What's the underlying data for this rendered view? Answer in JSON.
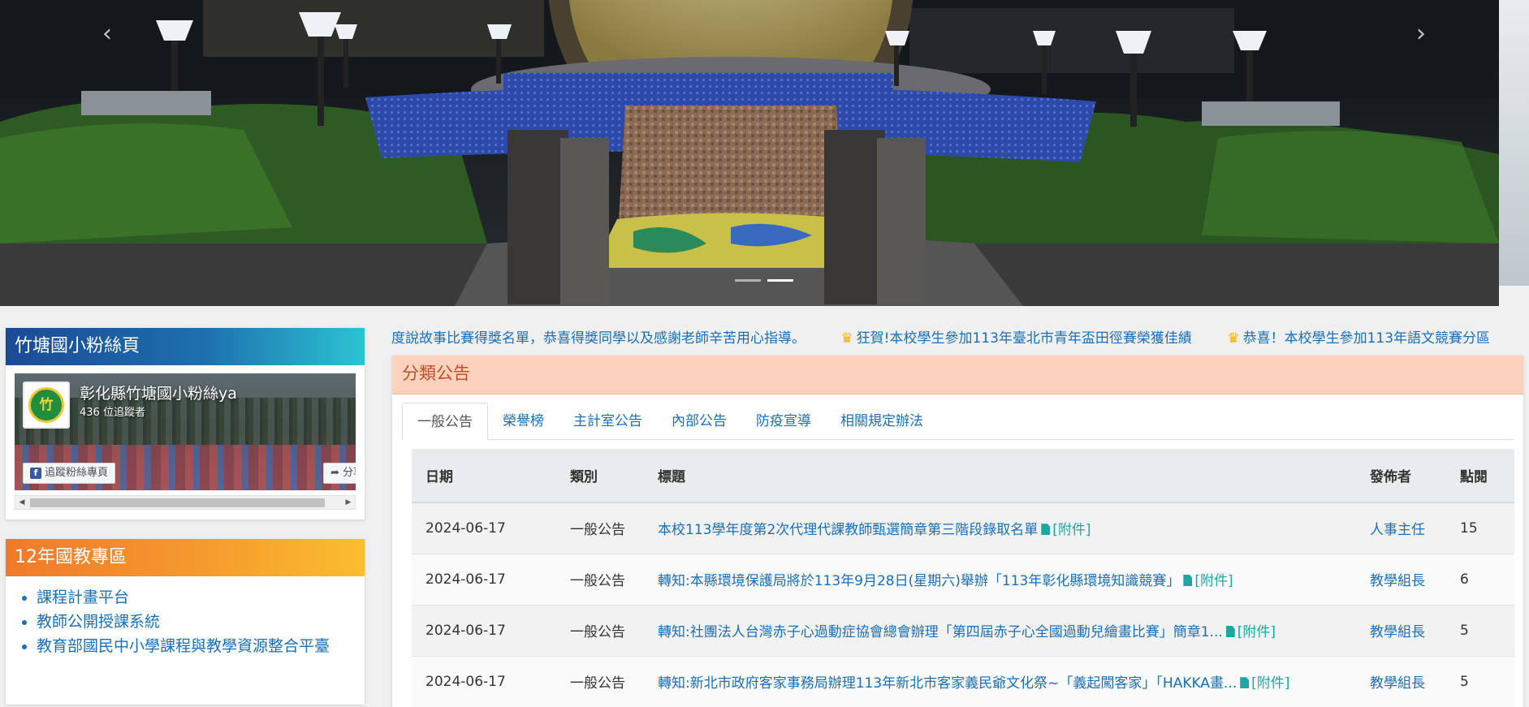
{
  "carousel": {
    "prev_icon": "chevron-left-icon",
    "next_icon": "chevron-right-icon",
    "prev_glyph": "‹",
    "next_glyph": "›",
    "slide_count": 2,
    "active_index": 1
  },
  "fans_panel": {
    "title": "竹塘國小粉絲頁",
    "page_name": "彰化縣竹塘國小粉絲ya",
    "followers": "436 位追蹤者",
    "follow_label": "追蹤粉絲專頁",
    "share_label": "分享",
    "logo_text": "竹"
  },
  "edu_panel": {
    "title": "12年國教專區",
    "links": [
      "課程計畫平台",
      "教師公開授課系統",
      "教育部國民中小學課程與教學資源整合平臺"
    ]
  },
  "marquee": {
    "items": [
      "度說故事比賽得獎名單，恭喜得獎同學以及感謝老師辛苦用心指導。",
      "狂賀!本校學生參加113年臺北市青年盃田徑賽榮獲佳績",
      "恭喜！本校學生參加113年語文競賽分區"
    ]
  },
  "announcements": {
    "title": "分類公告",
    "tabs": [
      "一般公告",
      "榮譽榜",
      "主計室公告",
      "內部公告",
      "防疫宣導",
      "相關規定辦法"
    ],
    "active_tab": 0,
    "columns": [
      "日期",
      "類別",
      "標題",
      "發佈者",
      "點閱"
    ],
    "attachment_label": "[附件]",
    "rows": [
      {
        "date": "2024-06-17",
        "category": "一般公告",
        "title": "本校113學年度第2次代理代課教師甄選簡章第三階段錄取名單",
        "publisher": "人事主任",
        "views": "15"
      },
      {
        "date": "2024-06-17",
        "category": "一般公告",
        "title": "轉知:本縣環境保護局將於113年9月28日(星期六)舉辦「113年彰化縣環境知識競賽」",
        "publisher": "教學組長",
        "views": "6"
      },
      {
        "date": "2024-06-17",
        "category": "一般公告",
        "title": "轉知:社團法人台灣赤子心過動症協會總會辦理「第四屆赤子心全國過動兒繪畫比賽」簡章1...",
        "publisher": "教學組長",
        "views": "5"
      },
      {
        "date": "2024-06-17",
        "category": "一般公告",
        "title": "轉知:新北市政府客家事務局辦理113年新北市客家義民爺文化祭~「義起闖客家」「HAKKA畫...",
        "publisher": "教學組長",
        "views": "5"
      }
    ]
  }
}
